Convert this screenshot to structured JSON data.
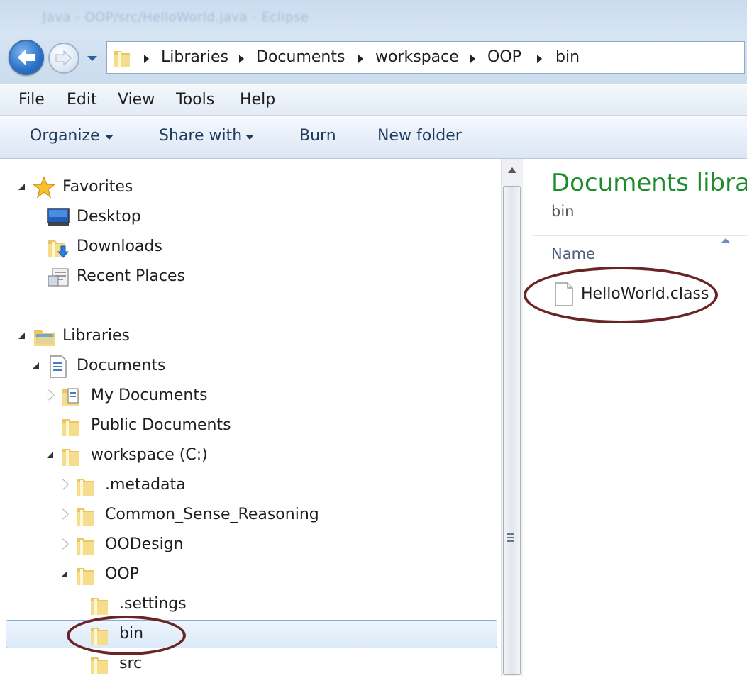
{
  "window": {
    "title": "Java - OOP/src/HelloWorld.java - Eclipse"
  },
  "address_bar": {
    "crumbs": [
      "Libraries",
      "Documents",
      "workspace",
      "OOP",
      "bin"
    ]
  },
  "menu": {
    "items": [
      "File",
      "Edit",
      "View",
      "Tools",
      "Help"
    ]
  },
  "command_bar": {
    "organize": "Organize",
    "share_with": "Share with",
    "burn": "Burn",
    "new_folder": "New folder"
  },
  "nav_tree": {
    "favorites": {
      "label": "Favorites",
      "items": [
        "Desktop",
        "Downloads",
        "Recent Places"
      ]
    },
    "libraries": {
      "label": "Libraries",
      "documents": "Documents",
      "my_documents": "My Documents",
      "public_documents": "Public Documents",
      "workspace": "workspace (C:)",
      "metadata": ".metadata",
      "common_sense": "Common_Sense_Reasoning",
      "oodesign": "OODesign",
      "oop": "OOP",
      "settings": ".settings",
      "bin": "bin",
      "src": "src"
    }
  },
  "content": {
    "library_title": "Documents library",
    "subtitle": "bin",
    "column_name": "Name",
    "files": [
      "HelloWorld.class"
    ]
  },
  "colors": {
    "library_title": "#1e8c2c",
    "annotation": "#6b2424",
    "selection": "#dbeaf9"
  }
}
